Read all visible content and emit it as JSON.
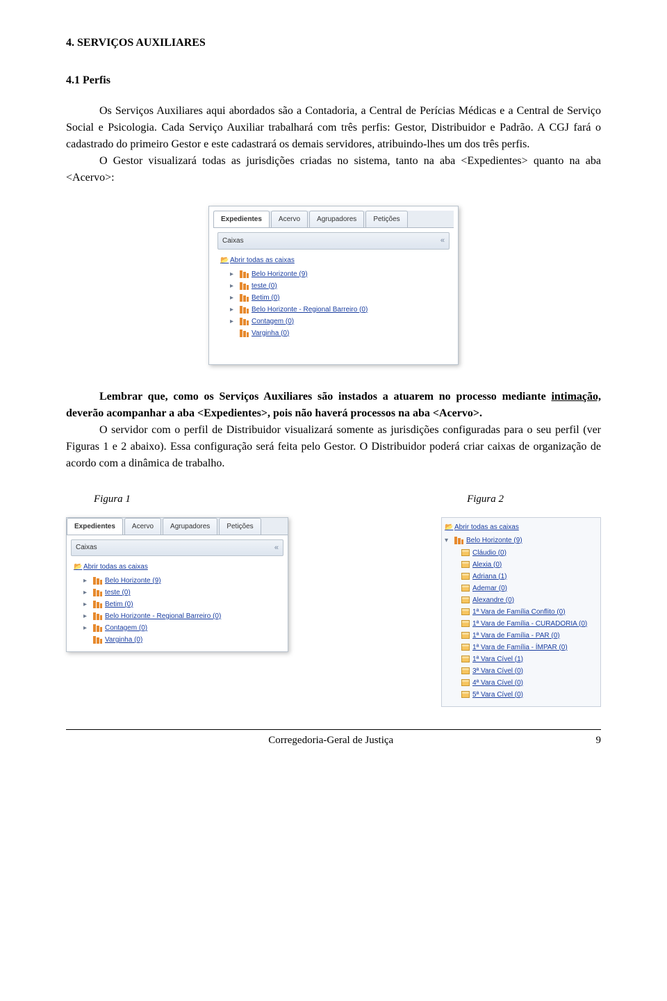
{
  "h1": "4. SERVIÇOS AUXILIARES",
  "h2": "4.1 Perfis",
  "p1": "Os Serviços Auxiliares aqui abordados são a Contadoria, a Central de Perícias Médicas e a Central de Serviço Social e Psicologia. Cada Serviço Auxiliar trabalhará com três perfis: Gestor, Distribuidor e Padrão. A CGJ fará o cadastrado do primeiro Gestor e este cadastrará os demais servidores, atribuindo-lhes um dos três perfis.",
  "p2": "O Gestor visualizará todas as jurisdições criadas no sistema, tanto na aba <Expedientes> quanto na aba <Acervo>:",
  "p3a": "Lembrar que, como os Serviços Auxiliares são instados a atuarem no processo mediante ",
  "p3b": "intimação,",
  "p3c": " deverão acompanhar a aba <Expedientes>, pois não haverá processos na aba <Acervo>.",
  "p4": "O servidor com o perfil de Distribuidor visualizará somente as jurisdições configuradas para o seu perfil (ver Figuras 1 e 2 abaixo). Essa configuração será feita pelo Gestor. O Distribuidor poderá criar caixas de organização de acordo com a dinâmica de trabalho.",
  "fig1": "Figura 1",
  "fig2": "Figura 2",
  "ui": {
    "tabs": {
      "expedientes": "Expedientes",
      "acervo": "Acervo",
      "agrupadores": "Agrupadores",
      "peticoes": "Petições"
    },
    "caixas": "Caixas",
    "root": "Abrir todas as caixas",
    "nodes": {
      "bh9": "Belo Horizonte (9)",
      "teste": "teste (0)",
      "betim": "Betim (0)",
      "bhrb": "Belo Horizonte - Regional Barreiro (0)",
      "contagem": "Contagem (0)",
      "varginha": "Varginha (0)"
    },
    "right": {
      "root": "Abrir todas as caixas",
      "bh9": "Belo Horizonte (9)",
      "leaves": {
        "claudio": "Cláudio (0)",
        "alexia": "Alexia (0)",
        "adriana": "Adriana (1)",
        "ademar": "Ademar (0)",
        "alexandre": "Alexandre (0)",
        "vf_conflito": "1ª Vara de Família Conflito (0)",
        "vf_curadoria": "1ª Vara de Família - CURADORIA (0)",
        "vf_par": "1ª Vara de Família - PAR (0)",
        "vf_impar": "1ª Vara de Família - ÍMPAR (0)",
        "vc1": "1ª Vara Cível (1)",
        "vc3": "3ª Vara Cível (0)",
        "vc4": "4ª Vara Cível (0)",
        "vc5": "5ª Vara Cível (0)"
      }
    }
  },
  "footer": {
    "org": "Corregedoria-Geral de Justiça",
    "page": "9"
  }
}
